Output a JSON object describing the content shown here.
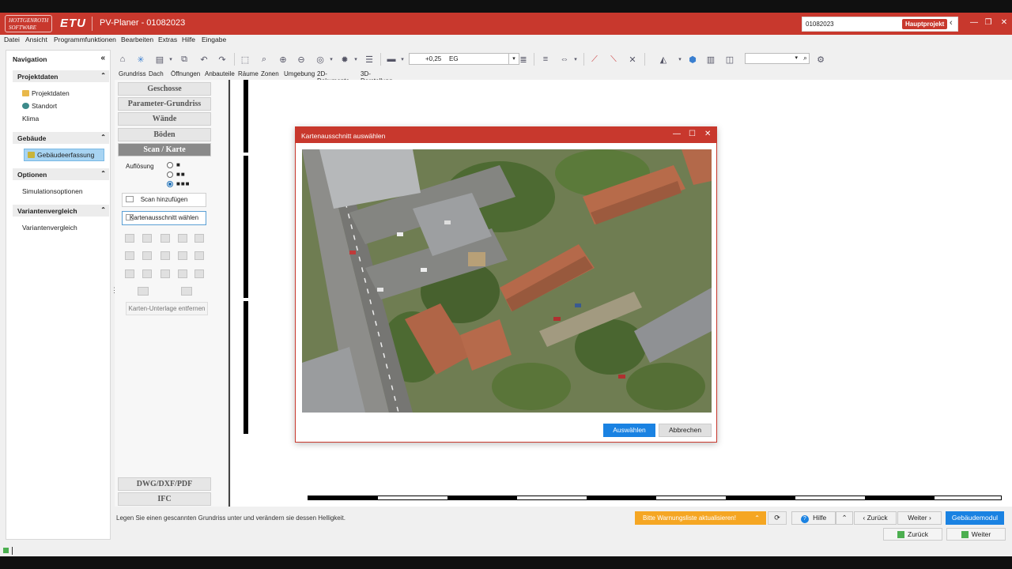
{
  "app": {
    "logo_text": "HOTTGENROTH SOFTWARE",
    "brand": "ETU",
    "title": "PV-Planer - 01082023",
    "project_value": "01082023",
    "project_badge": "Hauptprojekt",
    "accent": "#c8382d"
  },
  "menu": [
    "Datei",
    "Ansicht",
    "Programmfunktionen",
    "Bearbeiten",
    "Extras",
    "Hilfe",
    "Eingabe"
  ],
  "nav": {
    "title": "Navigation",
    "sections": [
      {
        "title": "Projektdaten",
        "items": [
          "Projektdaten",
          "Standort",
          "Klima"
        ]
      },
      {
        "title": "Gebäude",
        "items": [
          "Gebäudeerfassung"
        ]
      },
      {
        "title": "Optionen",
        "items": [
          "Simulationsoptionen"
        ]
      },
      {
        "title": "Variantenvergleich",
        "items": [
          "Variantenvergleich"
        ]
      }
    ]
  },
  "toolbar": {
    "zoom_value": "+0,25",
    "floor": "EG"
  },
  "tabs": [
    "Grundriss",
    "Dach",
    "Öffnungen",
    "Anbauteile",
    "Räume",
    "Zonen",
    "Umgebung",
    "2D-Dokumente",
    "3D-Darstellung"
  ],
  "panel": {
    "buttons": [
      "Geschosse",
      "Parameter-Grundriss",
      "Wände",
      "Böden",
      "Scan / Karte"
    ],
    "aufloesung_label": "Auflösung",
    "aufloesung_selected": 3,
    "scan_add": "Scan hinzufügen",
    "map_select": "Kartenausschnitt wählen",
    "remove": "Karten-Unterlage entfernen",
    "bottom_buttons": [
      "DWG/DXF/PDF",
      "IFC"
    ]
  },
  "dialog": {
    "title": "Kartenausschnitt auswählen",
    "ok": "Auswählen",
    "cancel": "Abbrechen"
  },
  "status": {
    "text": "Legen Sie einen gescannten Grundriss unter und verändern sie dessen Helligkeit.",
    "warning": "Bitte Warnungsliste aktualisieren!",
    "help": "Hilfe",
    "back": "Zurück",
    "next": "Weiter",
    "module": "Gebäudemodul",
    "bottom_back": "Zurück",
    "bottom_next": "Weiter"
  }
}
